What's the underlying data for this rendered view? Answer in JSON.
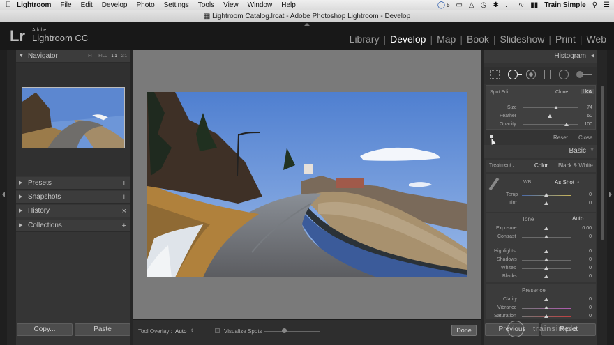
{
  "menubar": {
    "items": [
      "Lightroom",
      "File",
      "Edit",
      "Develop",
      "Photo",
      "Settings",
      "Tools",
      "View",
      "Window",
      "Help"
    ],
    "right": {
      "cc_badge": "5",
      "user": "Train Simple"
    }
  },
  "window": {
    "title": "Lightroom Catalog.lrcat - Adobe Photoshop Lightroom - Develop"
  },
  "identity": {
    "logo": "Lr",
    "adobe": "Adobe",
    "product": "Lightroom CC"
  },
  "modules": [
    {
      "label": "Library"
    },
    {
      "label": "Develop",
      "active": true
    },
    {
      "label": "Map"
    },
    {
      "label": "Book"
    },
    {
      "label": "Slideshow"
    },
    {
      "label": "Print"
    },
    {
      "label": "Web"
    }
  ],
  "left": {
    "navigator": {
      "title": "Navigator",
      "zoom": [
        "FIT",
        "FILL",
        "1:1",
        "2:1"
      ]
    },
    "panels": [
      {
        "label": "Presets",
        "action": "+"
      },
      {
        "label": "Snapshots",
        "action": "+"
      },
      {
        "label": "History",
        "action": "×"
      },
      {
        "label": "Collections",
        "action": "+"
      }
    ],
    "copy_label": "Copy...",
    "paste_label": "Paste"
  },
  "toolbar": {
    "overlay_label": "Tool Overlay :",
    "overlay_value": "Auto",
    "visualize_label": "Visualize Spots",
    "done_label": "Done"
  },
  "right": {
    "histogram_title": "Histogram",
    "spot": {
      "title": "Spot Edit :",
      "clone": "Clone",
      "heal": "Heal",
      "size_label": "Size",
      "size": "74",
      "feather_label": "Feather",
      "feather": "60",
      "opacity_label": "Opacity",
      "opacity": "100",
      "reset": "Reset",
      "close": "Close"
    },
    "basic": {
      "title": "Basic",
      "treatment_label": "Treatment :",
      "color": "Color",
      "bw": "Black & White",
      "wb_label": "WB :",
      "wb_value": "As Shot",
      "temp_label": "Temp",
      "temp": "0",
      "tint_label": "Tint",
      "tint": "0",
      "tone_label": "Tone",
      "auto_label": "Auto",
      "exposure_label": "Exposure",
      "exposure": "0.00",
      "contrast_label": "Contrast",
      "contrast": "0",
      "highlights_label": "Highlights",
      "highlights": "0",
      "shadows_label": "Shadows",
      "shadows": "0",
      "whites_label": "Whites",
      "whites": "0",
      "blacks_label": "Blacks",
      "blacks": "0",
      "presence_label": "Presence",
      "clarity_label": "Clarity",
      "clarity": "0",
      "vibrance_label": "Vibrance",
      "vibrance": "0",
      "saturation_label": "Saturation",
      "saturation": "0"
    },
    "previous_label": "Previous",
    "reset_label": "Reset"
  },
  "watermark": "trainsimple",
  "colors": {
    "accent": "#ffffff",
    "panel": "#343434",
    "canvas": "#7a7a7a"
  }
}
